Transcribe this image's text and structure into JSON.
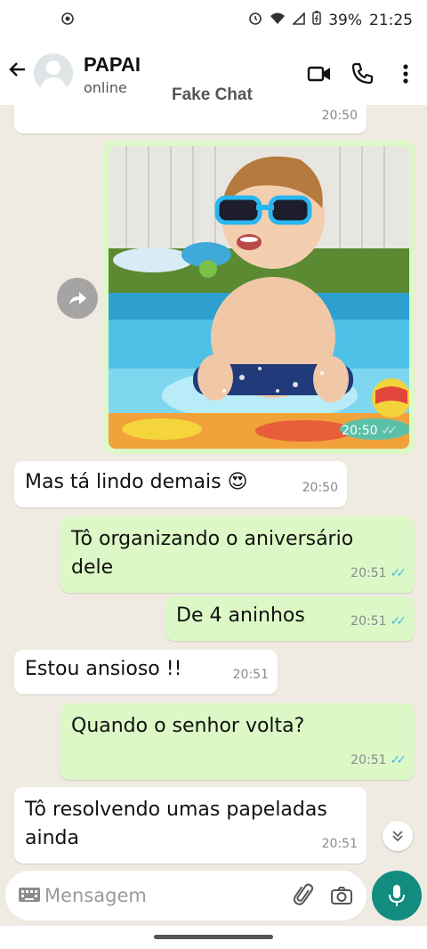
{
  "status_bar": {
    "battery": "39%",
    "time": "21:25"
  },
  "header": {
    "contact_name": "PAPAI",
    "contact_status": "online",
    "watermark": "Fake Chat"
  },
  "messages": [
    {
      "direction": "in",
      "text": "",
      "time": "20:50"
    },
    {
      "direction": "out",
      "type": "image",
      "image": "baby-with-sunglasses-in-pool",
      "time": "20:50"
    },
    {
      "direction": "in",
      "text": "Mas tá lindo demais 😍",
      "time": "20:50"
    },
    {
      "direction": "out",
      "text": "Tô organizando o aniversário dele",
      "time": "20:51"
    },
    {
      "direction": "out",
      "text": "De 4 aninhos",
      "time": "20:51"
    },
    {
      "direction": "in",
      "text": "Estou ansioso !!",
      "time": "20:51"
    },
    {
      "direction": "out",
      "text": "Quando o senhor volta?",
      "time": "20:51"
    },
    {
      "direction": "in",
      "text": "Tô resolvendo umas papeladas ainda",
      "time": "20:51"
    }
  ],
  "composer": {
    "placeholder": "Mensagem"
  },
  "icons": {
    "back": "arrow-left-icon",
    "video": "video-camera-icon",
    "call": "phone-icon",
    "menu": "more-vert-icon",
    "forward": "forward-icon",
    "keyboard": "keyboard-icon",
    "attach": "paperclip-icon",
    "camera": "camera-icon",
    "mic": "mic-icon",
    "scroll": "chevron-double-down-icon"
  },
  "colors": {
    "chat_bg": "#efeae2",
    "outgoing": "#dcf8c6",
    "incoming": "#ffffff",
    "accent": "#128c7e",
    "read_ticks": "#4fb6ec"
  }
}
